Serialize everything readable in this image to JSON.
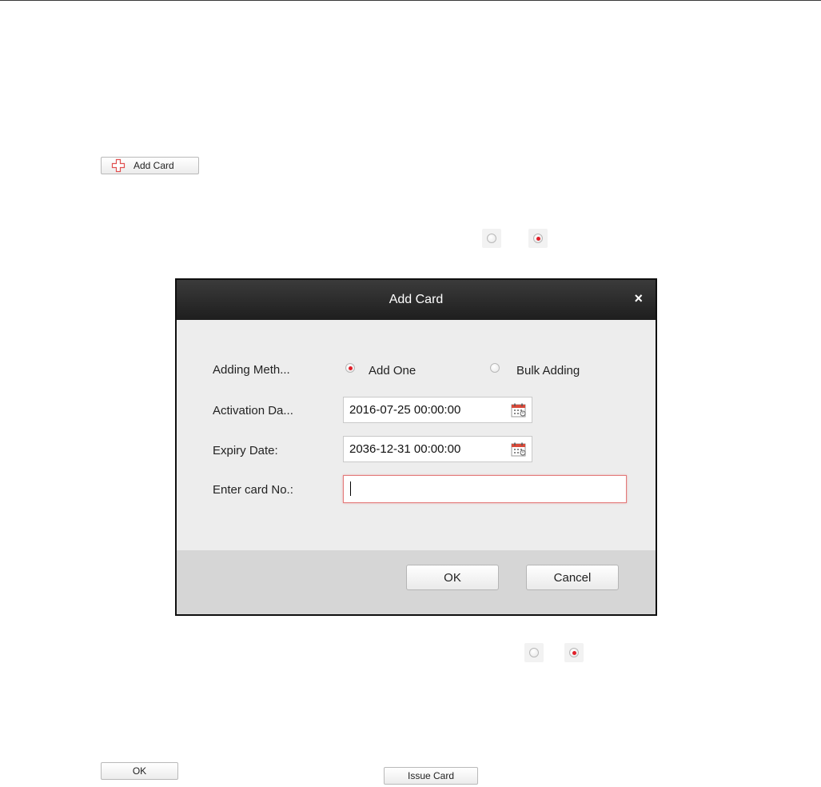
{
  "document": {
    "add_card_button_label": "Add Card",
    "ok_button_label": "OK",
    "issue_card_button_label": "Issue Card"
  },
  "dialog": {
    "title": "Add Card",
    "close_glyph": "×",
    "adding_method_label": "Adding Meth...",
    "add_one_label": "Add One",
    "bulk_adding_label": "Bulk Adding",
    "adding_method_selected": "Add One",
    "activation_date_label": "Activation Da...",
    "activation_date_value": "2016-07-25 00:00:00",
    "expiry_date_label": "Expiry Date:",
    "expiry_date_value": "2036-12-31 00:00:00",
    "card_no_label": "Enter card No.:",
    "card_no_value": "",
    "ok_label": "OK",
    "cancel_label": "Cancel"
  },
  "icons": {
    "add": "plus-icon",
    "calendar": "calendar-icon",
    "close": "close-icon"
  },
  "colors": {
    "radio_selected": "#e0202a",
    "titlebar": "#262626",
    "input_error_border": "#e37a7a"
  }
}
